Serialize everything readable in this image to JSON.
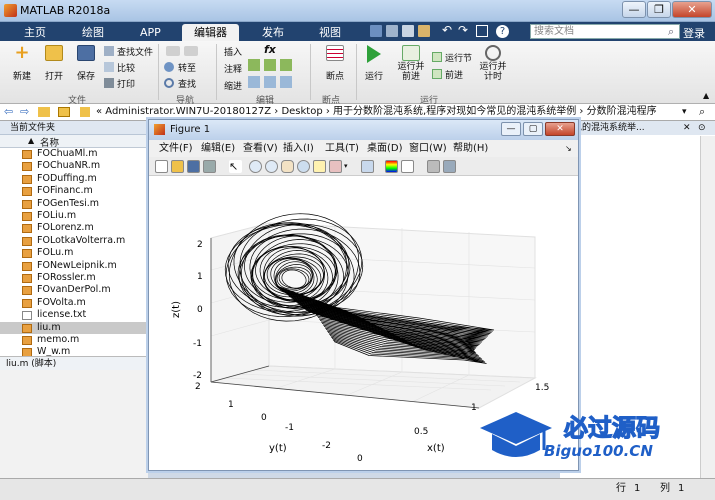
{
  "window": {
    "title": "MATLAB R2018a",
    "min": "—",
    "max": "❐",
    "close": "✕"
  },
  "tabs": [
    {
      "label": "主页"
    },
    {
      "label": "绘图"
    },
    {
      "label": "APP"
    },
    {
      "label": "编辑器"
    },
    {
      "label": "发布"
    },
    {
      "label": "视图"
    }
  ],
  "search": {
    "placeholder": "搜索文档"
  },
  "login": "登录",
  "ribbon": {
    "new": "新建",
    "open": "打开",
    "save": "保存",
    "find_files": "查找文件",
    "compare": "比较",
    "print": "打印",
    "goto": "转至",
    "find": "查找",
    "insert": "插入",
    "fx": "fx",
    "comment": "注释",
    "indent": "缩进",
    "breakpoints": "断点",
    "run": "运行",
    "run_advance": "运行并\n前进",
    "run_section": "运行节",
    "advance": "前进",
    "run_time": "运行并\n计时",
    "groups": {
      "file": "文件",
      "nav": "导航",
      "edit": "编辑",
      "bp": "断点",
      "run": "运行"
    }
  },
  "address": {
    "path": "« Administrator.WIN7U-20180127Z  ›  Desktop  ›  用于分数阶混沌系统,程序对现如今常见的混沌系统举例  ›  分数阶混沌程序"
  },
  "left_panel": {
    "header": "当前文件夹",
    "column": "名称",
    "files": [
      {
        "name": "FOChuaMl.m"
      },
      {
        "name": "FOChuaNR.m"
      },
      {
        "name": "FODuffing.m"
      },
      {
        "name": "FOFinanc.m"
      },
      {
        "name": "FOGenTesi.m"
      },
      {
        "name": "FOLiu.m"
      },
      {
        "name": "FOLorenz.m"
      },
      {
        "name": "FOLotkaVolterra.m"
      },
      {
        "name": "FOLu.m"
      },
      {
        "name": "FONewLeipnik.m"
      },
      {
        "name": "FORossler.m"
      },
      {
        "name": "FOvanDerPol.m"
      },
      {
        "name": "FOVolta.m"
      },
      {
        "name": "license.txt"
      },
      {
        "name": "liu.m"
      },
      {
        "name": "memo.m"
      },
      {
        "name": "W_w.m"
      }
    ],
    "selected_index": 14,
    "footer": "liu.m  (脚本)"
  },
  "right_panel": {
    "header": "常见的混沌系统举..."
  },
  "figure": {
    "title": "Figure 1",
    "menu": [
      "文件(F)",
      "编辑(E)",
      "查看(V)",
      "插入(I)",
      "工具(T)",
      "桌面(D)",
      "窗口(W)",
      "帮助(H)"
    ],
    "zlabel": "z(t)",
    "ylabel": "y(t)",
    "xlabel": "x(t)",
    "z_ticks": [
      "2",
      "1",
      "0",
      "-1",
      "-2"
    ],
    "y_ticks": [
      "2",
      "1",
      "0",
      "-1",
      "-2"
    ],
    "x_ticks": [
      "0",
      "0.5",
      "1",
      "1.5"
    ]
  },
  "status": {
    "row_label": "行",
    "row": "1",
    "col_label": "列",
    "col": "1"
  },
  "watermark": {
    "top": "必过源码",
    "bottom": "Biguo100.CN"
  }
}
